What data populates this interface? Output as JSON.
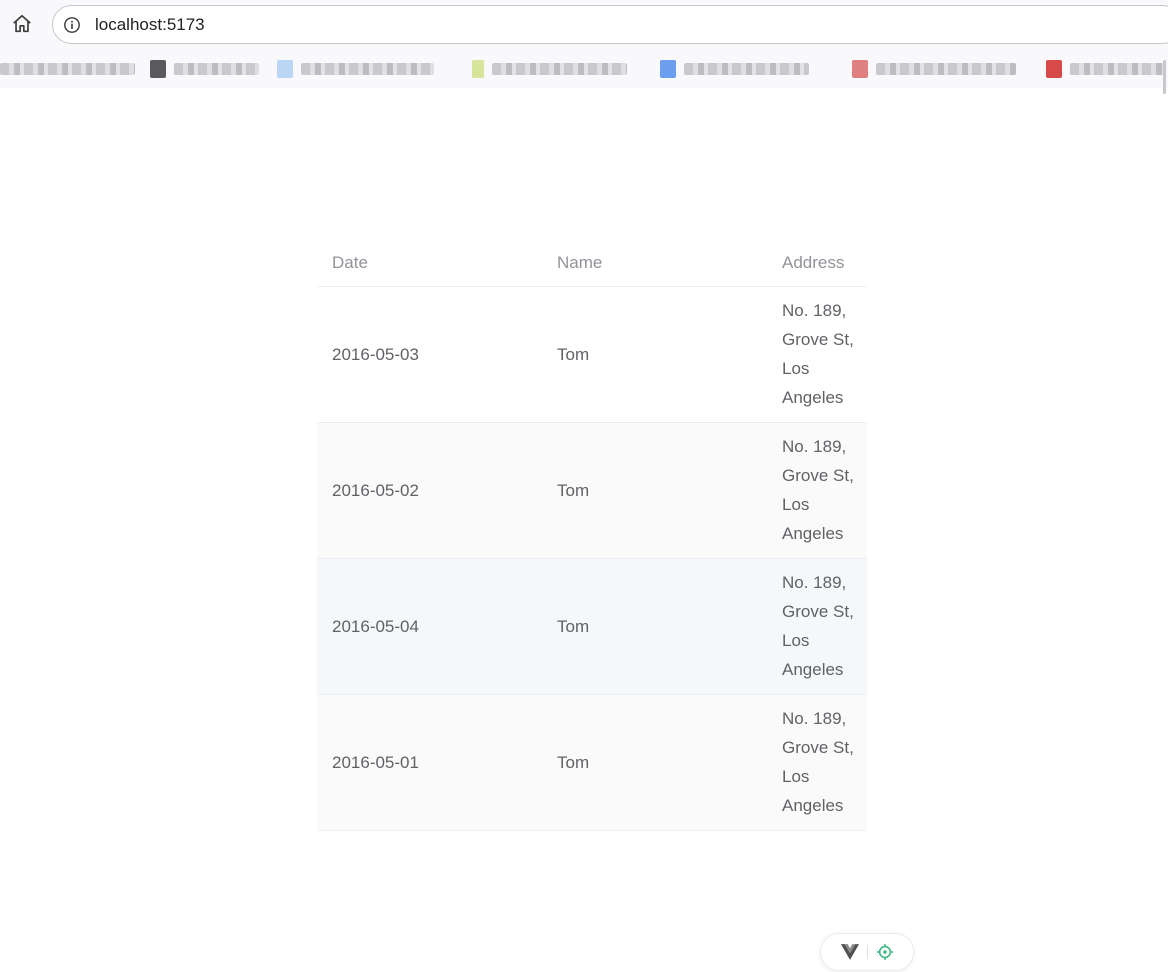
{
  "browser": {
    "url": "localhost:5173",
    "home_icon": "home-icon",
    "site_info_icon": "info-icon",
    "bookmarks_blurred": true
  },
  "table": {
    "headers": [
      "Date",
      "Name",
      "Address"
    ],
    "rows": [
      {
        "date": "2016-05-03",
        "name": "Tom",
        "address": "No. 189, Grove St, Los Angeles"
      },
      {
        "date": "2016-05-02",
        "name": "Tom",
        "address": "No. 189, Grove St, Los Angeles"
      },
      {
        "date": "2016-05-04",
        "name": "Tom",
        "address": "No. 189, Grove St, Los Angeles"
      },
      {
        "date": "2016-05-01",
        "name": "Tom",
        "address": "No. 189, Grove St, Los Angeles"
      }
    ],
    "hover_row_index": 2
  },
  "devtools": {
    "logo_icon": "vue-logo-icon",
    "inspect_icon": "crosshair-icon",
    "accent_color": "#42b883"
  },
  "colors": {
    "header_text": "#909399",
    "body_text": "#606266",
    "border": "#ebeef5",
    "stripe_bg": "#fafafa",
    "hover_bg": "#f5f7fa"
  }
}
